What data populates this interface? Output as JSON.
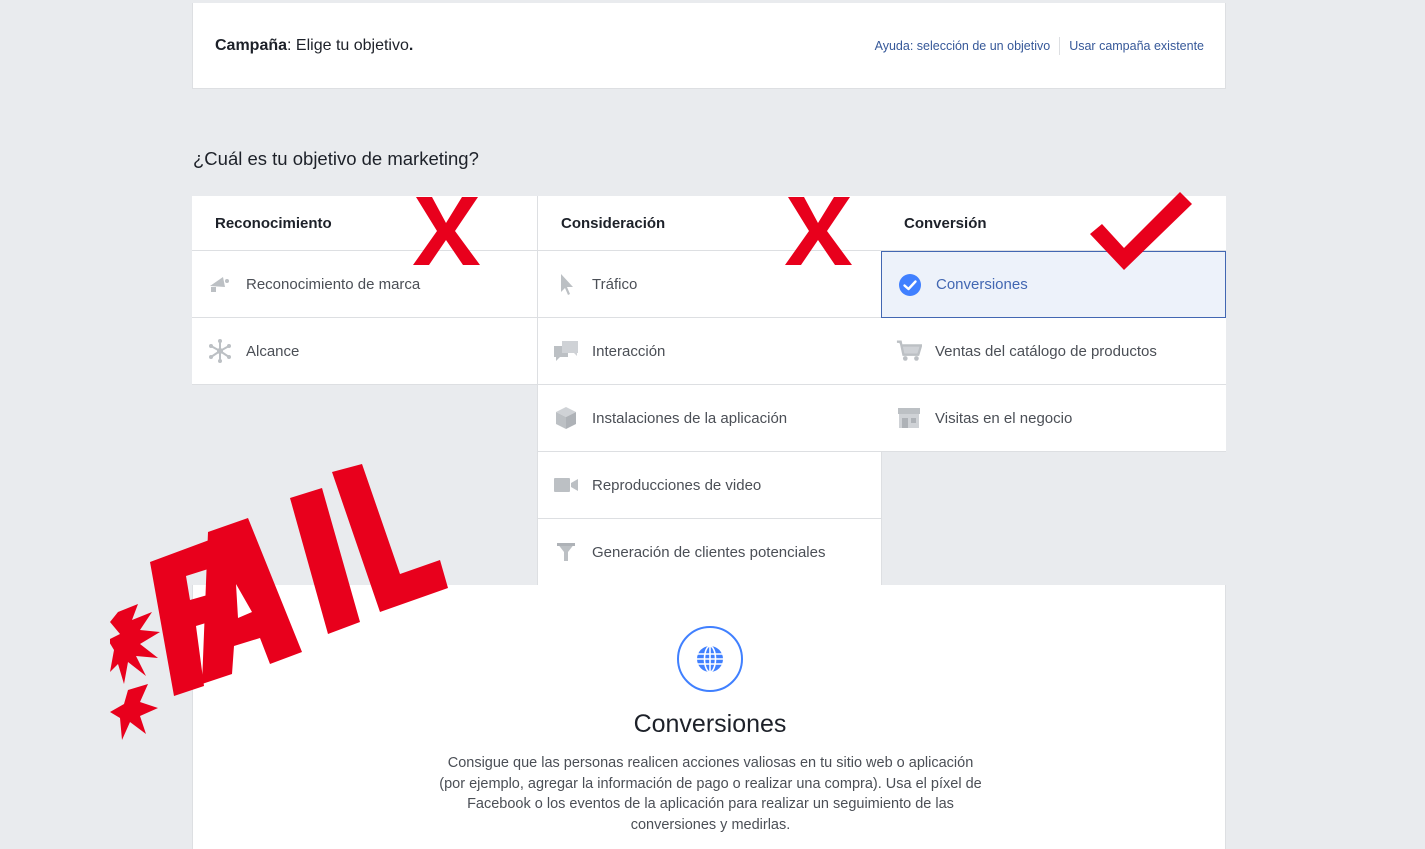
{
  "header": {
    "title_bold": "Campaña",
    "title_rest": ": Elige tu objetivo",
    "title_end": ".",
    "help_link": "Ayuda: selección de un objetivo",
    "existing_link": "Usar campaña existente"
  },
  "question": "¿Cuál es tu objetivo de marketing?",
  "columns": [
    {
      "heading": "Reconocimiento",
      "items": [
        {
          "label": "Reconocimiento de marca",
          "icon": "megaphone-icon"
        },
        {
          "label": "Alcance",
          "icon": "reach-icon"
        }
      ]
    },
    {
      "heading": "Consideración",
      "items": [
        {
          "label": "Tráfico",
          "icon": "cursor-icon"
        },
        {
          "label": "Interacción",
          "icon": "chat-bubbles-icon"
        },
        {
          "label": "Instalaciones de la aplicación",
          "icon": "cube-icon"
        },
        {
          "label": "Reproducciones de video",
          "icon": "video-camera-icon"
        },
        {
          "label": "Generación de clientes potenciales",
          "icon": "funnel-icon"
        }
      ]
    },
    {
      "heading": "Conversión",
      "items": [
        {
          "label": "Conversiones",
          "icon": "checkmark-circle-icon",
          "selected": true
        },
        {
          "label": "Ventas del catálogo de productos",
          "icon": "cart-icon"
        },
        {
          "label": "Visitas en el negocio",
          "icon": "store-icon"
        }
      ]
    }
  ],
  "detail": {
    "icon": "globe-icon",
    "title": "Conversiones",
    "description": "Consigue que las personas realicen acciones valiosas en tu sitio web o aplicación (por ejemplo, agregar la información de pago o realizar una compra). Usa el píxel de Facebook o los eventos de la aplicación para realizar un seguimiento de las conversiones y medirlas."
  },
  "annotations": {
    "stamp_text": "FAIL",
    "mark_color": "#e8001c",
    "accent_color": "#4267b2"
  }
}
